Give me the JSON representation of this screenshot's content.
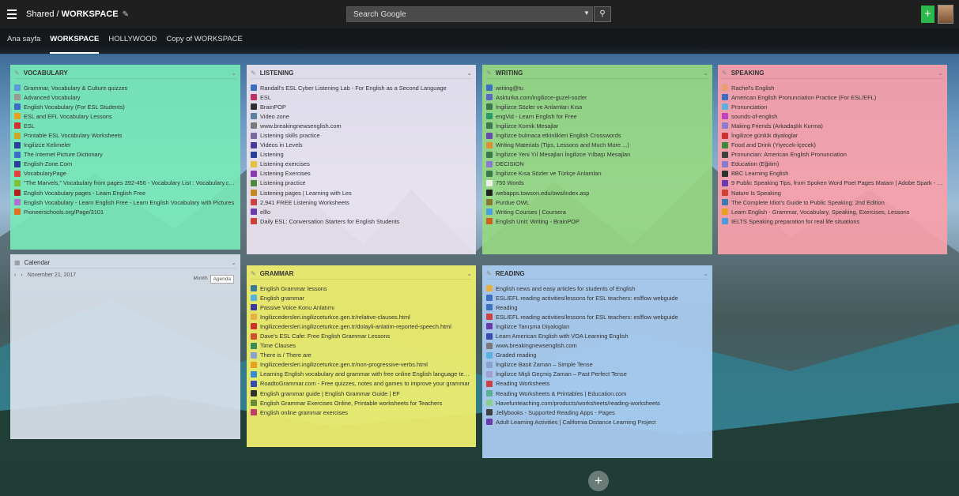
{
  "topbar": {
    "shared_label": "Shared / ",
    "workspace_label": "WORKSPACE",
    "search_placeholder": "Search Google",
    "add_label": "+"
  },
  "tabs": [
    {
      "label": "Ana sayfa"
    },
    {
      "label": "WORKSPACE"
    },
    {
      "label": "HOLLYWOOD"
    },
    {
      "label": "Copy of WORKSPACE"
    }
  ],
  "widgets": {
    "vocabulary": {
      "title": "VOCABULARY",
      "items": [
        {
          "label": "Grammar, Vocabulary & Culture quizzes",
          "color": "#5b9bd5"
        },
        {
          "label": "Advanced Vocabulary",
          "color": "#999999"
        },
        {
          "label": "English Vocabulary (For ESL Students)",
          "color": "#3a6fc4"
        },
        {
          "label": "ESL and EFL Vocabulary Lessons",
          "color": "#e8a020"
        },
        {
          "label": "ESL",
          "color": "#d03030"
        },
        {
          "label": "Printable ESL Vocabulary Worksheets",
          "color": "#c9a82a"
        },
        {
          "label": "Ingilizce Kelimeler",
          "color": "#2a3f9a"
        },
        {
          "label": "The Internet Picture Dictionary",
          "color": "#3a6fc4"
        },
        {
          "label": "English-Zone.Com",
          "color": "#2a3f9a"
        },
        {
          "label": "VocabularyPage",
          "color": "#e04040"
        },
        {
          "label": "\"The Marvels,\" Vocabulary from pages 392-456 - Vocabulary List : Vocabulary.com",
          "color": "#7fbf3a"
        },
        {
          "label": "English Vocabulary pages - Learn English Free",
          "color": "#b02020"
        },
        {
          "label": "English Vocabulary - Learn English Free - Learn English Vocabulary with Pictures",
          "color": "#b070d0"
        },
        {
          "label": "Pioneerschools.org/Page/3101",
          "color": "#e07020"
        }
      ]
    },
    "listening": {
      "title": "LISTENING",
      "items": [
        {
          "label": "Randall's ESL Cyber Listening Lab - For English as a Second Language",
          "color": "#3a6fc4"
        },
        {
          "label": "ESL",
          "color": "#c03060"
        },
        {
          "label": "BrainPOP",
          "color": "#303030"
        },
        {
          "label": "Video zone",
          "color": "#5b7fa0"
        },
        {
          "label": "www.breakingnewsenglish.com",
          "color": "#7a7a7a"
        },
        {
          "label": "Listening skills practice",
          "color": "#7a6aa0"
        },
        {
          "label": "Videos in Levels",
          "color": "#4a3aa0"
        },
        {
          "label": "Listening",
          "color": "#2a3f9a"
        },
        {
          "label": "Listening exercises",
          "color": "#e8c040"
        },
        {
          "label": "Listening Exercises",
          "color": "#8a3ab0"
        },
        {
          "label": "Listening practice",
          "color": "#4a8a3a"
        },
        {
          "label": "Listening pages | Learning with Les",
          "color": "#c08a20"
        },
        {
          "label": "2,941 FREE Listening Worksheets",
          "color": "#d04040"
        },
        {
          "label": "elllo",
          "color": "#6a3ab0"
        },
        {
          "label": "Daily ESL: Conversation Starters for English Students",
          "color": "#d04030"
        }
      ]
    },
    "writing": {
      "title": "WRITING",
      "items": [
        {
          "label": "writing@tu",
          "color": "#3a6fc4"
        },
        {
          "label": "Askturka.com/ingilizce-guzel-sozler",
          "color": "#5a6ac4"
        },
        {
          "label": "İngilizce Sözler ve Anlamları Kısa",
          "color": "#3a7a4a"
        },
        {
          "label": "engVid - Learn English for Free",
          "color": "#2a9a6a"
        },
        {
          "label": "İngilizce Komik Mesajlar",
          "color": "#3a7a4a"
        },
        {
          "label": "İngilizce bulmaca etkinlikleri English Crosswords",
          "color": "#6a4ab0"
        },
        {
          "label": "Writing Materials (Tips, Lessons and Much More ...)",
          "color": "#e09030"
        },
        {
          "label": "İngilizce Yeni Yıl Mesajları İngilizce Yılbaşı Mesajları",
          "color": "#3a7a4a"
        },
        {
          "label": "DECISION",
          "color": "#8a7ad0"
        },
        {
          "label": "İngilizce Kısa Sözler ve Türkçe Anlamları",
          "color": "#3a7a4a"
        },
        {
          "label": "750 Words",
          "color": "#eeeeee"
        },
        {
          "label": "webapps.towson.edu/ows/index.asp",
          "color": "#222222"
        },
        {
          "label": "Purdue OWL",
          "color": "#8a7a30"
        },
        {
          "label": "Writing Courses | Coursera",
          "color": "#4aa0e0"
        },
        {
          "label": "English Unit: Writing - BrainPOP",
          "color": "#d0601a"
        }
      ]
    },
    "speaking": {
      "title": "SPEAKING",
      "items": [
        {
          "label": "Rachel's English",
          "color": "#e8a070"
        },
        {
          "label": "American English Pronunciation Practice (For ESL/EFL)",
          "color": "#3a6fc4"
        },
        {
          "label": "Pronunciation",
          "color": "#5ab0e0"
        },
        {
          "label": "sounds-of-english",
          "color": "#c040c0"
        },
        {
          "label": "Making Friends (Arkadaşlık Kurma)",
          "color": "#8a7ad0"
        },
        {
          "label": "İngilizce günlük diyaloglar",
          "color": "#d03030"
        },
        {
          "label": "Food and Drink (Yiyecek-İçecek)",
          "color": "#3a8a3a"
        },
        {
          "label": "Pronuncian: American English Pronunciation",
          "color": "#404040"
        },
        {
          "label": "Education (Eğitim)",
          "color": "#8a7ad0"
        },
        {
          "label": "BBC Learning English",
          "color": "#303030"
        },
        {
          "label": "9 Public Speaking Tips, from Spoken Word Poet Pages Matam | Adobe Spark - Part 18",
          "color": "#6a3ab0"
        },
        {
          "label": "Nature Is Speaking",
          "color": "#d04030"
        },
        {
          "label": "The Complete Idiot's Guide to Public Speaking: 2nd Edition",
          "color": "#3a7ab0"
        },
        {
          "label": "Learn English - Grammar, Vocabulary, Speaking, Exercises, Lessons",
          "color": "#e8a020"
        },
        {
          "label": "IELTS Speaking preparation for real life situations",
          "color": "#4a9ae0"
        }
      ]
    },
    "calendar": {
      "title": "Calendar",
      "date": "November 21, 2017",
      "prev": "‹",
      "next": "›",
      "view_month": "Month",
      "view_agenda": "Agenda"
    },
    "grammar": {
      "title": "GRAMMAR",
      "items": [
        {
          "label": "English Grammar lessons",
          "color": "#3a7a9a"
        },
        {
          "label": "English grammar",
          "color": "#5ab0e0"
        },
        {
          "label": "Passive Voice Konu Anlatımı",
          "color": "#3a3aa0"
        },
        {
          "label": "Ingilizcedersleri.ingilizceturkce.gen.tr/relative-clauses.html",
          "color": "#e8b040"
        },
        {
          "label": "Ingilizcedersleri.ingilizceturkce.gen.tr/dolayli-anlatim-reported-speech.html",
          "color": "#d03030"
        },
        {
          "label": "Dave's ESL Cafe: Free English Grammar Lessons",
          "color": "#d05030"
        },
        {
          "label": "Time Clauses",
          "color": "#3a8a5a"
        },
        {
          "label": "There is / There are",
          "color": "#8aa0d0"
        },
        {
          "label": "Ingilizcedersleri.ingilizceturkce.gen.tr/non-progressive-verbs.html",
          "color": "#e8a020"
        },
        {
          "label": "Learning English vocabulary and grammar with free online English language tests, exe...",
          "color": "#3a8ad0"
        },
        {
          "label": "RoadtoGrammar.com - Free quizzes, notes and games to improve your grammar",
          "color": "#3a4ab0"
        },
        {
          "label": "English grammar guide | English Grammar Guide | EF",
          "color": "#303030"
        },
        {
          "label": "English Grammar Exercises Online, Printable worksheets for Teachers",
          "color": "#6a8a3a"
        },
        {
          "label": "English online grammar exercises",
          "color": "#c03a6a"
        }
      ]
    },
    "reading": {
      "title": "READING",
      "items": [
        {
          "label": "English news and easy articles for students of English",
          "color": "#e8b040"
        },
        {
          "label": "ESL/EFL reading activities/lessons for ESL teachers: eslflow webguide",
          "color": "#3a6fc4"
        },
        {
          "label": "Reading",
          "color": "#3a6fc4"
        },
        {
          "label": "ESL/EFL reading activities/lessons for ESL teachers: eslflow webguide",
          "color": "#d04040"
        },
        {
          "label": "İngilizce Tanışma Diyalogları",
          "color": "#6a3ab0"
        },
        {
          "label": "Learn American English with VOA Learning English",
          "color": "#3a4ab0"
        },
        {
          "label": "www.breakingnewsenglish.com",
          "color": "#7a7a7a"
        },
        {
          "label": "Graded reading",
          "color": "#5ab0e0"
        },
        {
          "label": "İngilizce Basit Zaman – Simple Tense",
          "color": "#8aa0d0"
        },
        {
          "label": "İngilizce Mişli Geçmiş Zaman – Past Perfect Tense",
          "color": "#a0a0d0"
        },
        {
          "label": "Reading Worksheets",
          "color": "#d04040"
        },
        {
          "label": "Reading Worksheets & Printables | Education.com",
          "color": "#5ab090"
        },
        {
          "label": "Havefunteaching.com/products/worksheets/reading-worksheets",
          "color": "#8ad08a"
        },
        {
          "label": "Jellybooks - Supported Reading Apps - Pages",
          "color": "#404040"
        },
        {
          "label": "Adult Learning Activities | California Distance Learning Project",
          "color": "#6a3ab0"
        }
      ]
    }
  },
  "fab": {
    "label": "+"
  }
}
